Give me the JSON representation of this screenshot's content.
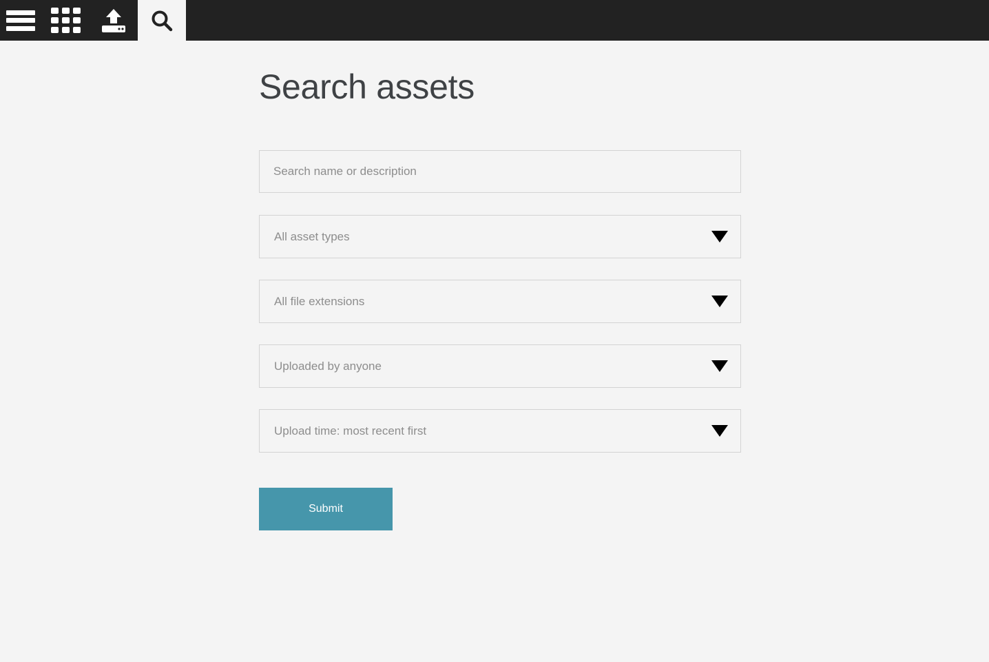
{
  "topbar": {
    "tabs": [
      {
        "name": "menu",
        "icon": "hamburger-icon",
        "label": "Menu",
        "active": false
      },
      {
        "name": "browse",
        "icon": "grid-icon",
        "label": "Browse assets",
        "active": false
      },
      {
        "name": "upload",
        "icon": "upload-icon",
        "label": "Upload",
        "active": false
      },
      {
        "name": "search",
        "icon": "search-icon",
        "label": "Search assets",
        "active": true
      }
    ],
    "background_color": "#222222",
    "active_tab_color": "#f4f4f4"
  },
  "page": {
    "title": "Search assets",
    "background_color": "#f4f4f4",
    "title_color": "#3f4245"
  },
  "form": {
    "search": {
      "value": "",
      "placeholder": "Search name or description"
    },
    "asset_type": {
      "selected": "All asset types"
    },
    "file_extension": {
      "selected": "All file extensions"
    },
    "uploader": {
      "selected": "Uploaded by anyone"
    },
    "sort_order": {
      "selected": "Upload time: most recent first"
    },
    "submit_label": "Submit",
    "submit_color": "#4696ab"
  }
}
